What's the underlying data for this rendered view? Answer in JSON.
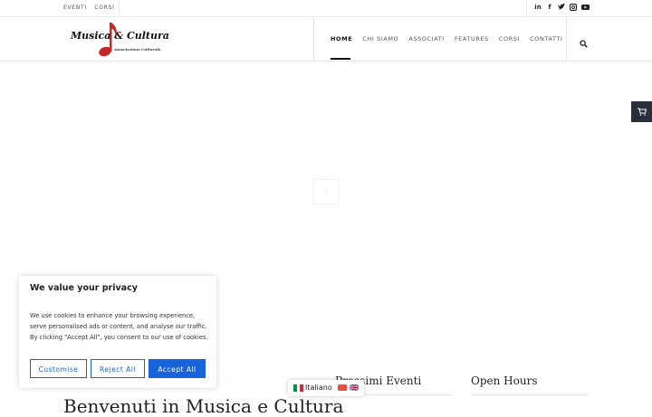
{
  "topbar": {
    "links": [
      "EVENTI",
      "CORSI"
    ],
    "social_icons": [
      "linkedin-icon",
      "facebook-icon",
      "twitter-icon",
      "instagram-icon",
      "youtube-icon"
    ]
  },
  "logo": {
    "title": "Musica & Cultura",
    "subtitle": "Associazione Culturale"
  },
  "nav": {
    "items": [
      "HOME",
      "CHI SIAMO",
      "ASSOCIATI",
      "FEATURES",
      "CORSI",
      "CONTATTI"
    ],
    "active": "HOME"
  },
  "slider": {
    "arrow_glyph": "‹"
  },
  "sections": {
    "events_title": "Prossimi Eventi",
    "hours_title": "Open Hours",
    "welcome_title": "Benvenuti in Musica e Cultura"
  },
  "cookie": {
    "title": "We value your privacy",
    "body": "We use cookies to enhance your browsing experience, serve personalised ads or content, and analyse our traffic. By clicking \"Accept All\", you consent to our use of cookies.",
    "customise": "Customise",
    "reject": "Reject All",
    "accept": "Accept All"
  },
  "language": {
    "label": "Italiano",
    "secondary": "🇬🇧"
  },
  "colors": {
    "accent": "#1863dc",
    "cart_bg": "#2a2f3d",
    "logo_note": "#c62828"
  }
}
